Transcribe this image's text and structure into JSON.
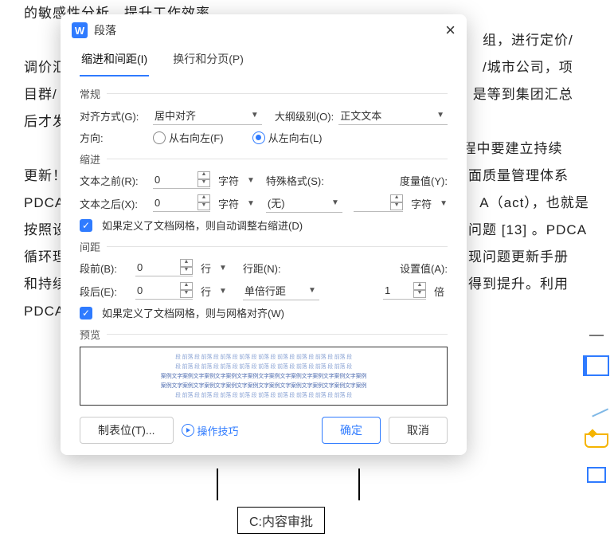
{
  "bg": {
    "text": "的敏感性分析。提升工作效率。\n　　　　　　　　　　　　　　　　　　　　　　　　　　　　　　　　组，进行定价/\n调价汇　　　　　　　　　　　　　　　　　　　　　　　　　　　　　/城市公司，项\n目群/　　　　　　　　　　　　　　　　　　　　　　　　　　　　　是等到集团汇总\n后才发\n　　　4　　　　　　　　　　　　　　　　　　　　　　　　　　　程中要建立持续\n更新！　　　　　　　　　　　　　　　　　　　　　　　　　　　　面质量管理体系\nPDCA　　　　　　　　　　　　　　　　　　　　　　　　　　　　　A（act），也就是\n按照设　　　　　　　　　　　　　　　　　　　　　　　　　　　　问题 [13] 。PDCA\n循环理　　　　　　　　　　　　　　　　　　　　　　　　　　　　现问题更新手册\n和持续　　　　　　　　　　　　　　　　　　　　　　　　　　　　得到提升。利用\nPDCA",
    "box": "C:内容审批"
  },
  "dialog": {
    "title": "段落",
    "tabs": {
      "indent": "缩进和间距(I)",
      "page": "换行和分页(P)"
    },
    "general": {
      "heading": "常规",
      "align_label": "对齐方式(G):",
      "align_value": "居中对齐",
      "outline_label": "大纲级别(O):",
      "outline_value": "正文文本",
      "dir_label": "方向:",
      "rtl": "从右向左(F)",
      "ltr": "从左向右(L)"
    },
    "indent": {
      "heading": "缩进",
      "before_label": "文本之前(R):",
      "before_value": "0",
      "after_label": "文本之后(X):",
      "after_value": "0",
      "unit": "字符",
      "special_label": "特殊格式(S):",
      "special_value": "(无)",
      "measure_label": "度量值(Y):",
      "measure_unit": "字符",
      "chk": "如果定义了文档网格，则自动调整右缩进(D)"
    },
    "spacing": {
      "heading": "间距",
      "before_label": "段前(B):",
      "before_value": "0",
      "after_label": "段后(E):",
      "after_value": "0",
      "unit": "行",
      "line_label": "行距(N):",
      "line_value": "单倍行距",
      "set_label": "设置值(A):",
      "set_value": "1",
      "set_unit": "倍",
      "chk": "如果定义了文档网格，则与网格对齐(W)"
    },
    "preview": {
      "heading": "预览",
      "filler": "段 前落 段 前落 段 前落 段 前落 段 前落 段 前落 段 前落 段 前落 段 前落 段",
      "sample": "案例文字案例文字案例文字案例文字案例文字案例文字案例文字案例文字案例文字案例"
    },
    "footer": {
      "tabs_btn": "制表位(T)...",
      "tips": "操作技巧",
      "ok": "确定",
      "cancel": "取消"
    }
  }
}
